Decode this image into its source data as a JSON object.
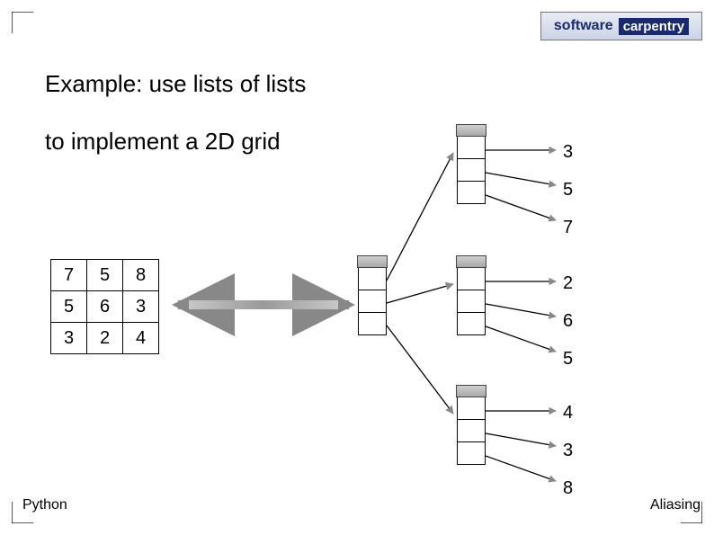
{
  "logo": {
    "word1": "software",
    "word2": "carpentry"
  },
  "title": "Example: use lists of lists",
  "subtitle": "to implement a 2D grid",
  "grid": {
    "rows": [
      {
        "c0": "7",
        "c1": "5",
        "c2": "8"
      },
      {
        "c0": "5",
        "c1": "6",
        "c2": "3"
      },
      {
        "c0": "3",
        "c1": "2",
        "c2": "4"
      }
    ]
  },
  "inner_lists": {
    "list0": {
      "v0": "3",
      "v1": "5",
      "v2": "7"
    },
    "list1": {
      "v0": "2",
      "v1": "6",
      "v2": "5"
    },
    "list2": {
      "v0": "4",
      "v1": "3",
      "v2": "8"
    }
  },
  "footer": {
    "left": "Python",
    "right": "Aliasing"
  }
}
